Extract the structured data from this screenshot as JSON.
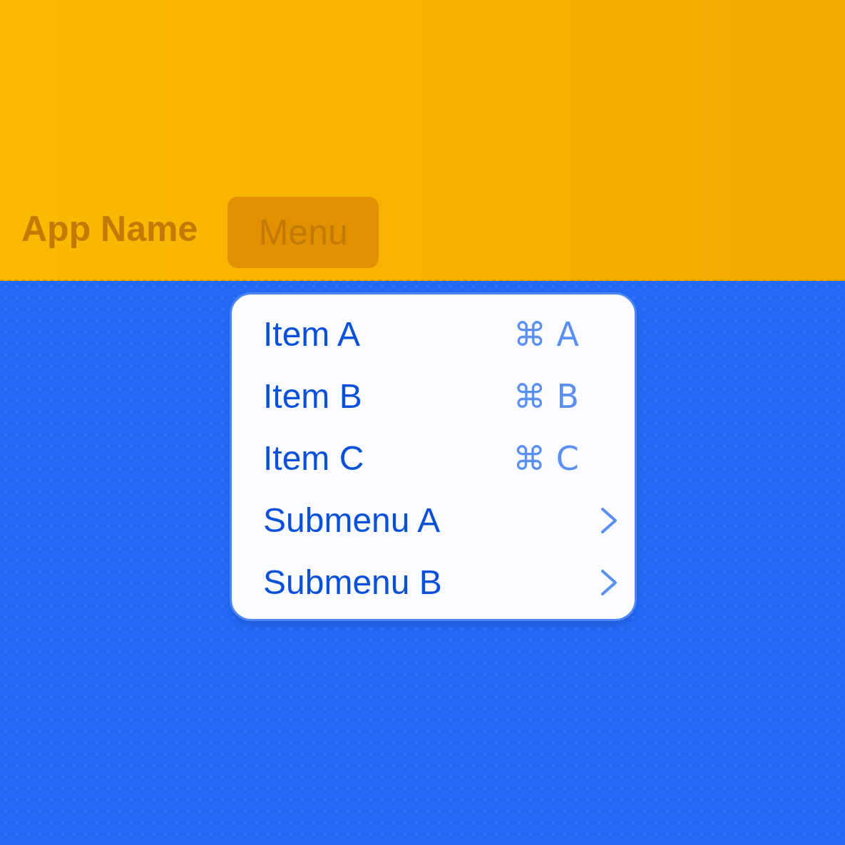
{
  "header": {
    "app_name": "App Name",
    "menu_button": {
      "label": "Menu",
      "expanded": true
    }
  },
  "menu": {
    "items": [
      {
        "kind": "item",
        "label": "Item A",
        "shortcut": "⌘ A"
      },
      {
        "kind": "item",
        "label": "Item B",
        "shortcut": "⌘ B"
      },
      {
        "kind": "item",
        "label": "Item C",
        "shortcut": "⌘ C"
      },
      {
        "kind": "submenu",
        "label": "Submenu A"
      },
      {
        "kind": "submenu",
        "label": "Submenu B"
      }
    ]
  }
}
